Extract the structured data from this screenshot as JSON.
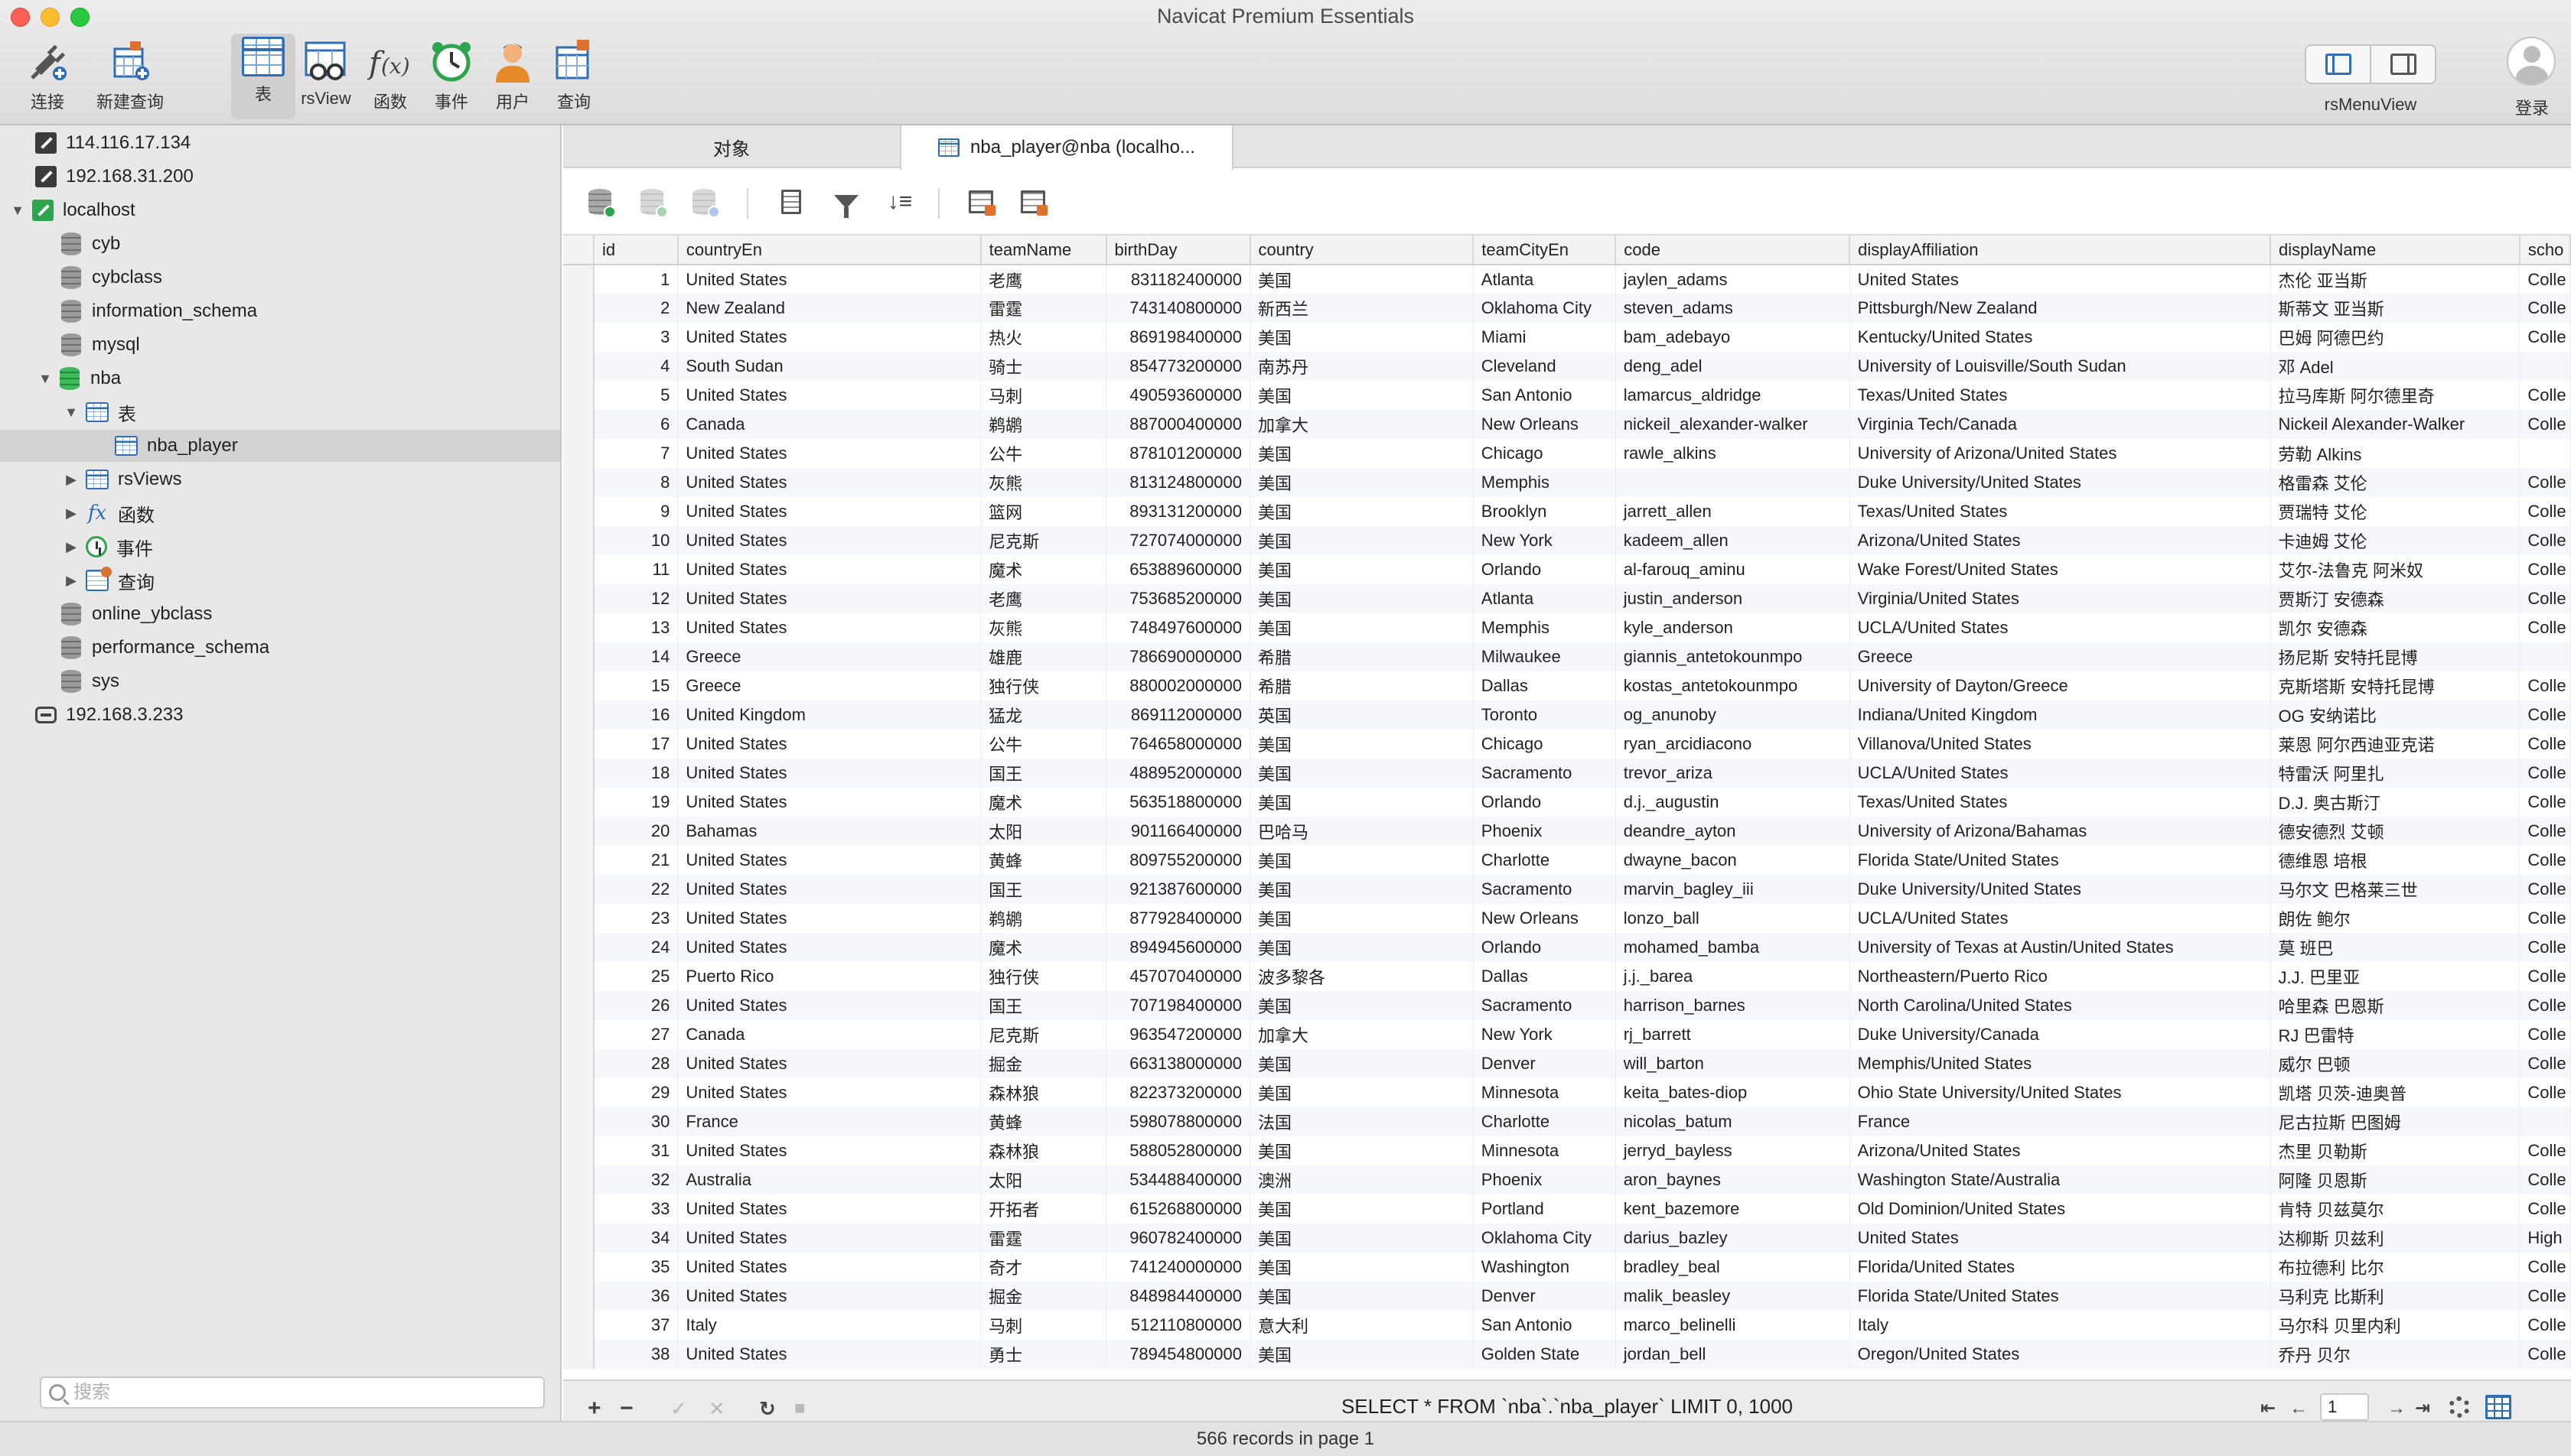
{
  "window": {
    "title": "Navicat Premium Essentials"
  },
  "toolbar": {
    "connect": "连接",
    "new_query": "新建查询",
    "table": "表",
    "rsview": "rsView",
    "function": "函数",
    "event": "事件",
    "user": "用户",
    "query": "查询",
    "rs_menu_view": "rsMenuView",
    "login": "登录"
  },
  "sidebar": {
    "connections": [
      {
        "label": "114.116.17.134"
      },
      {
        "label": "192.168.31.200"
      },
      {
        "label": "localhost"
      }
    ],
    "databases": [
      "cyb",
      "cybclass",
      "information_schema",
      "mysql",
      "nba",
      "online_ybclass",
      "performance_schema",
      "sys"
    ],
    "nba_children": {
      "tables": "表",
      "table_item": "nba_player",
      "rsviews": "rsViews",
      "functions": "函数",
      "events": "事件",
      "queries": "查询"
    },
    "last_connection": "192.168.3.233",
    "search_placeholder": "搜索"
  },
  "tabs": {
    "objects": "对象",
    "active": "nba_player@nba (localho..."
  },
  "grid": {
    "columns": [
      "id",
      "countryEn",
      "teamName",
      "birthDay",
      "country",
      "teamCityEn",
      "code",
      "displayAffiliation",
      "displayName",
      "scho"
    ],
    "rows": [
      [
        "1",
        "United States",
        "老鹰",
        "831182400000",
        "美国",
        "Atlanta",
        "jaylen_adams",
        "United States",
        "杰伦 亚当斯",
        "Colle"
      ],
      [
        "2",
        "New Zealand",
        "雷霆",
        "743140800000",
        "新西兰",
        "Oklahoma City",
        "steven_adams",
        "Pittsburgh/New Zealand",
        "斯蒂文 亚当斯",
        "Colle"
      ],
      [
        "3",
        "United States",
        "热火",
        "869198400000",
        "美国",
        "Miami",
        "bam_adebayo",
        "Kentucky/United States",
        "巴姆 阿德巴约",
        "Colle"
      ],
      [
        "4",
        "South Sudan",
        "骑士",
        "854773200000",
        "南苏丹",
        "Cleveland",
        "deng_adel",
        "University of Louisville/South Sudan",
        "邓 Adel",
        ""
      ],
      [
        "5",
        "United States",
        "马刺",
        "490593600000",
        "美国",
        "San Antonio",
        "lamarcus_aldridge",
        "Texas/United States",
        "拉马库斯 阿尔德里奇",
        "Colle"
      ],
      [
        "6",
        "Canada",
        "鹈鹕",
        "887000400000",
        "加拿大",
        "New Orleans",
        "nickeil_alexander-walker",
        "Virginia Tech/Canada",
        "Nickeil Alexander-Walker",
        "Colle"
      ],
      [
        "7",
        "United States",
        "公牛",
        "878101200000",
        "美国",
        "Chicago",
        "rawle_alkins",
        "University of Arizona/United States",
        "劳勒 Alkins",
        ""
      ],
      [
        "8",
        "United States",
        "灰熊",
        "813124800000",
        "美国",
        "Memphis",
        "",
        "Duke University/United States",
        "格雷森 艾伦",
        "Colle"
      ],
      [
        "9",
        "United States",
        "篮网",
        "893131200000",
        "美国",
        "Brooklyn",
        "jarrett_allen",
        "Texas/United States",
        "贾瑞特 艾伦",
        "Colle"
      ],
      [
        "10",
        "United States",
        "尼克斯",
        "727074000000",
        "美国",
        "New York",
        "kadeem_allen",
        "Arizona/United States",
        "卡迪姆 艾伦",
        "Colle"
      ],
      [
        "11",
        "United States",
        "魔术",
        "653889600000",
        "美国",
        "Orlando",
        "al-farouq_aminu",
        "Wake Forest/United States",
        "艾尔-法鲁克 阿米奴",
        "Colle"
      ],
      [
        "12",
        "United States",
        "老鹰",
        "753685200000",
        "美国",
        "Atlanta",
        "justin_anderson",
        "Virginia/United States",
        "贾斯汀 安德森",
        "Colle"
      ],
      [
        "13",
        "United States",
        "灰熊",
        "748497600000",
        "美国",
        "Memphis",
        "kyle_anderson",
        "UCLA/United States",
        "凯尔 安德森",
        "Colle"
      ],
      [
        "14",
        "Greece",
        "雄鹿",
        "786690000000",
        "希腊",
        "Milwaukee",
        "giannis_antetokounmpo",
        "Greece",
        "扬尼斯 安特托昆博",
        ""
      ],
      [
        "15",
        "Greece",
        "独行侠",
        "880002000000",
        "希腊",
        "Dallas",
        "kostas_antetokounmpo",
        "University of Dayton/Greece",
        "克斯塔斯 安特托昆博",
        "Colle"
      ],
      [
        "16",
        "United Kingdom",
        "猛龙",
        "869112000000",
        "英国",
        "Toronto",
        "og_anunoby",
        "Indiana/United Kingdom",
        "OG 安纳诺比",
        "Colle"
      ],
      [
        "17",
        "United States",
        "公牛",
        "764658000000",
        "美国",
        "Chicago",
        "ryan_arcidiacono",
        "Villanova/United States",
        "莱恩 阿尔西迪亚克诺",
        "Colle"
      ],
      [
        "18",
        "United States",
        "国王",
        "488952000000",
        "美国",
        "Sacramento",
        "trevor_ariza",
        "UCLA/United States",
        "特雷沃 阿里扎",
        "Colle"
      ],
      [
        "19",
        "United States",
        "魔术",
        "563518800000",
        "美国",
        "Orlando",
        "d.j._augustin",
        "Texas/United States",
        "D.J. 奥古斯汀",
        "Colle"
      ],
      [
        "20",
        "Bahamas",
        "太阳",
        "901166400000",
        "巴哈马",
        "Phoenix",
        "deandre_ayton",
        "University of Arizona/Bahamas",
        "德安德烈 艾顿",
        "Colle"
      ],
      [
        "21",
        "United States",
        "黄蜂",
        "809755200000",
        "美国",
        "Charlotte",
        "dwayne_bacon",
        "Florida State/United States",
        "德维恩 培根",
        "Colle"
      ],
      [
        "22",
        "United States",
        "国王",
        "921387600000",
        "美国",
        "Sacramento",
        "marvin_bagley_iii",
        "Duke University/United States",
        "马尔文 巴格莱三世",
        "Colle"
      ],
      [
        "23",
        "United States",
        "鹈鹕",
        "877928400000",
        "美国",
        "New Orleans",
        "lonzo_ball",
        "UCLA/United States",
        "朗佐 鲍尔",
        "Colle"
      ],
      [
        "24",
        "United States",
        "魔术",
        "894945600000",
        "美国",
        "Orlando",
        "mohamed_bamba",
        "University of Texas at Austin/United States",
        "莫 班巴",
        "Colle"
      ],
      [
        "25",
        "Puerto Rico",
        "独行侠",
        "457070400000",
        "波多黎各",
        "Dallas",
        "j.j._barea",
        "Northeastern/Puerto Rico",
        "J.J. 巴里亚",
        "Colle"
      ],
      [
        "26",
        "United States",
        "国王",
        "707198400000",
        "美国",
        "Sacramento",
        "harrison_barnes",
        "North Carolina/United States",
        "哈里森 巴恩斯",
        "Colle"
      ],
      [
        "27",
        "Canada",
        "尼克斯",
        "963547200000",
        "加拿大",
        "New York",
        "rj_barrett",
        "Duke University/Canada",
        "RJ 巴雷特",
        "Colle"
      ],
      [
        "28",
        "United States",
        "掘金",
        "663138000000",
        "美国",
        "Denver",
        "will_barton",
        "Memphis/United States",
        "威尔 巴顿",
        "Colle"
      ],
      [
        "29",
        "United States",
        "森林狼",
        "822373200000",
        "美国",
        "Minnesota",
        "keita_bates-diop",
        "Ohio State University/United States",
        "凯塔 贝茨-迪奥普",
        "Colle"
      ],
      [
        "30",
        "France",
        "黄蜂",
        "598078800000",
        "法国",
        "Charlotte",
        "nicolas_batum",
        "France",
        "尼古拉斯 巴图姆",
        ""
      ],
      [
        "31",
        "United States",
        "森林狼",
        "588052800000",
        "美国",
        "Minnesota",
        "jerryd_bayless",
        "Arizona/United States",
        "杰里 贝勒斯",
        "Colle"
      ],
      [
        "32",
        "Australia",
        "太阳",
        "534488400000",
        "澳洲",
        "Phoenix",
        "aron_baynes",
        "Washington State/Australia",
        "阿隆 贝恩斯",
        "Colle"
      ],
      [
        "33",
        "United States",
        "开拓者",
        "615268800000",
        "美国",
        "Portland",
        "kent_bazemore",
        "Old Dominion/United States",
        "肯特 贝兹莫尔",
        "Colle"
      ],
      [
        "34",
        "United States",
        "雷霆",
        "960782400000",
        "美国",
        "Oklahoma City",
        "darius_bazley",
        "United States",
        "达柳斯 贝兹利",
        "High"
      ],
      [
        "35",
        "United States",
        "奇才",
        "741240000000",
        "美国",
        "Washington",
        "bradley_beal",
        "Florida/United States",
        "布拉德利 比尔",
        "Colle"
      ],
      [
        "36",
        "United States",
        "掘金",
        "848984400000",
        "美国",
        "Denver",
        "malik_beasley",
        "Florida State/United States",
        "马利克 比斯利",
        "Colle"
      ],
      [
        "37",
        "Italy",
        "马刺",
        "512110800000",
        "意大利",
        "San Antonio",
        "marco_belinelli",
        "Italy",
        "马尔科 贝里内利",
        "Colle"
      ],
      [
        "38",
        "United States",
        "勇士",
        "789454800000",
        "美国",
        "Golden State",
        "jordan_bell",
        "Oregon/United States",
        "乔丹 贝尔",
        "Colle"
      ]
    ]
  },
  "status": {
    "sql": "SELECT * FROM `nba`.`nba_player` LIMIT 0, 1000",
    "page": "1",
    "records": "566 records in page 1"
  }
}
